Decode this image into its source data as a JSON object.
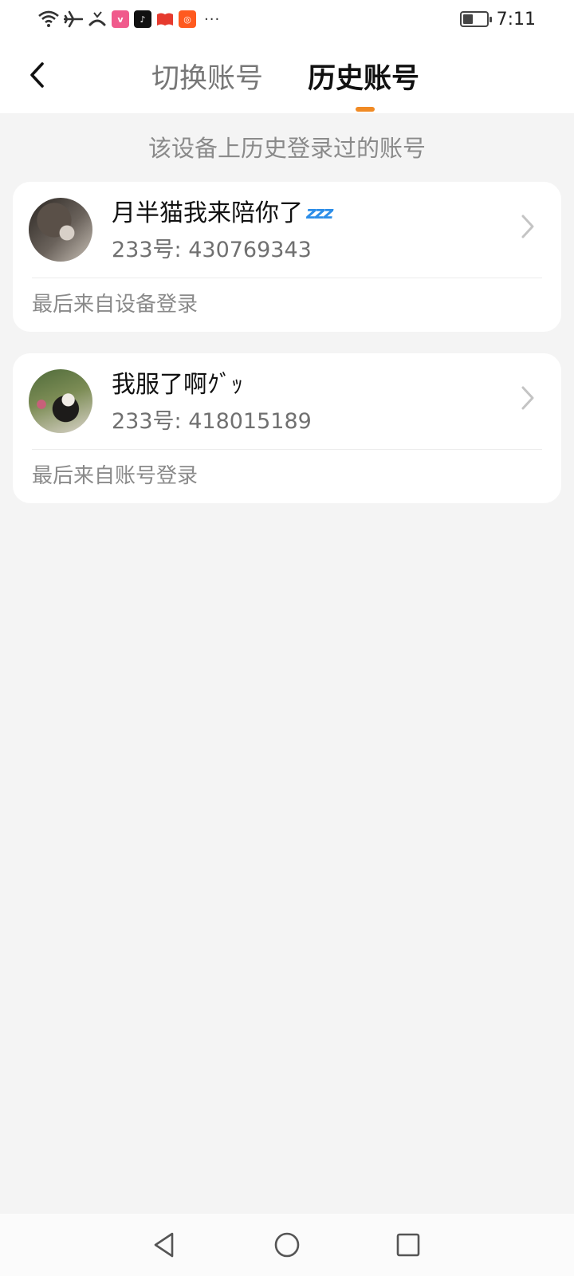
{
  "status_bar": {
    "time": "7:11",
    "battery_level": 0.4,
    "icons": [
      "wifi-icon",
      "airplane-icon",
      "missed-call-icon",
      "vivo-app-icon",
      "tiktok-app-icon",
      "book-app-icon",
      "kuaishou-app-icon"
    ],
    "more_indicator": "···"
  },
  "header": {
    "back_icon": "chevron-left-icon",
    "tabs": [
      {
        "label": "切换账号",
        "active": false
      },
      {
        "label": "历史账号",
        "active": true
      }
    ],
    "accent_color": "#f08a24"
  },
  "subtitle": "该设备上历史登录过的账号",
  "accounts": [
    {
      "name": "月半猫我来陪你了",
      "name_emoji": "💤",
      "uid": "233号: 430769343",
      "login_source": "最后来自设备登录",
      "avatar": "avatar-photo-1"
    },
    {
      "name": "我服了啊ｸﾞｯ",
      "uid": "233号: 418015189",
      "login_source": "最后来自账号登录",
      "avatar": "avatar-photo-2"
    }
  ],
  "bottom_nav": {
    "icons": [
      "back-triangle-icon",
      "home-circle-icon",
      "recents-square-icon"
    ]
  }
}
